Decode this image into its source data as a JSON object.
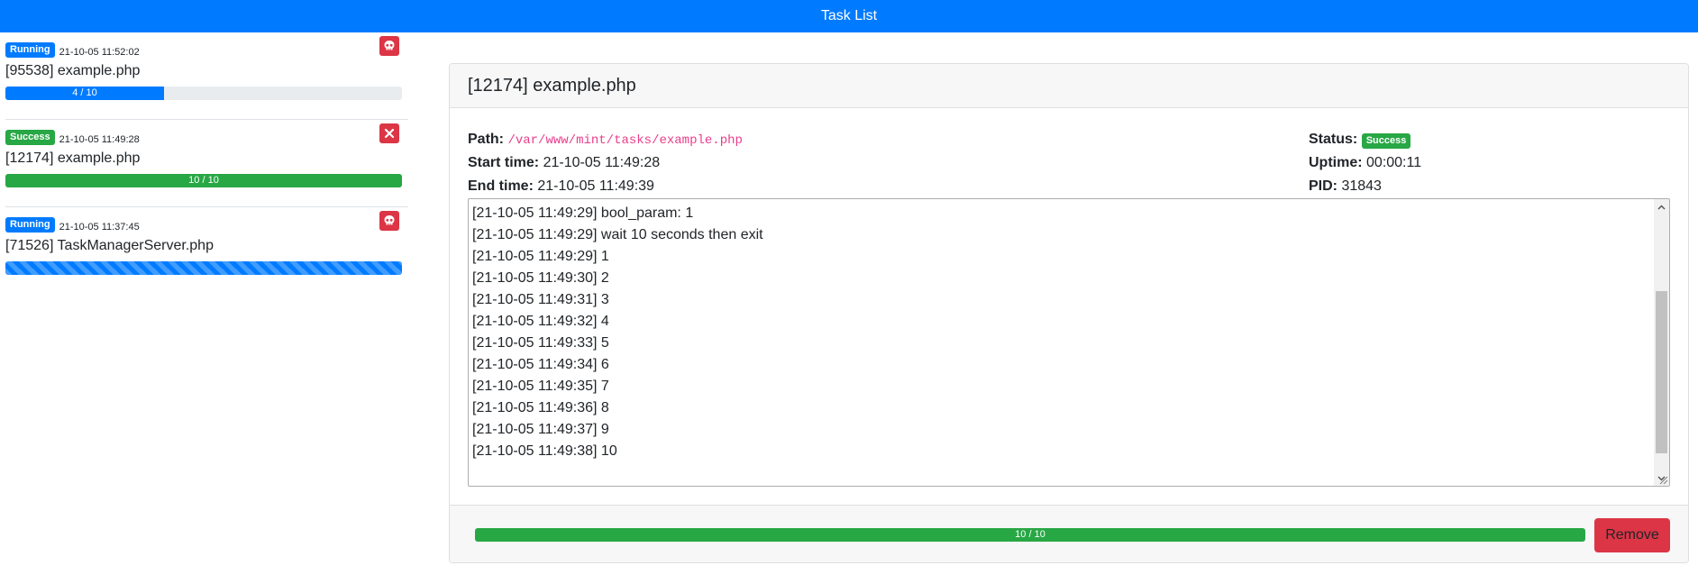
{
  "header": {
    "title": "Task List"
  },
  "tasks": [
    {
      "status": "Running",
      "status_color": "#007bff",
      "time": "21-10-05 11:52:02",
      "title": "[95538] example.php",
      "progress_label": "4 / 10",
      "progress": 0.4,
      "action_icon": "skull-icon"
    },
    {
      "status": "Success",
      "status_color": "#28a745",
      "time": "21-10-05 11:49:28",
      "title": "[12174] example.php",
      "progress_label": "10 / 10",
      "progress": 1.0,
      "action_icon": "close-icon"
    },
    {
      "status": "Running",
      "status_color": "#007bff",
      "time": "21-10-05 11:37:45",
      "title": "[71526] TaskManagerServer.php",
      "progress_label": "",
      "progress": 1.0,
      "action_icon": "skull-icon"
    }
  ],
  "detail": {
    "title": "[12174] example.php",
    "path_label": "Path:",
    "path": "/var/www/mint/tasks/example.php",
    "start_label": "Start time:",
    "start": "21-10-05 11:49:28",
    "end_label": "End time:",
    "end": "21-10-05 11:49:39",
    "status_label": "Status:",
    "status": "Success",
    "uptime_label": "Uptime:",
    "uptime": "00:00:11",
    "pid_label": "PID:",
    "pid": "31843",
    "log": [
      "[21-10-05 11:49:29] bool_param: 1",
      "[21-10-05 11:49:29] wait 10 seconds then exit",
      "[21-10-05 11:49:29] 1",
      "[21-10-05 11:49:30] 2",
      "[21-10-05 11:49:31] 3",
      "[21-10-05 11:49:32] 4",
      "[21-10-05 11:49:33] 5",
      "[21-10-05 11:49:34] 6",
      "[21-10-05 11:49:35] 7",
      "[21-10-05 11:49:36] 8",
      "[21-10-05 11:49:37] 9",
      "[21-10-05 11:49:38] 10"
    ],
    "progress_label": "10 / 10",
    "progress": 1.0,
    "remove_label": "Remove"
  },
  "colors": {
    "primary": "#007bff",
    "success": "#28a745",
    "danger": "#dc3545"
  }
}
